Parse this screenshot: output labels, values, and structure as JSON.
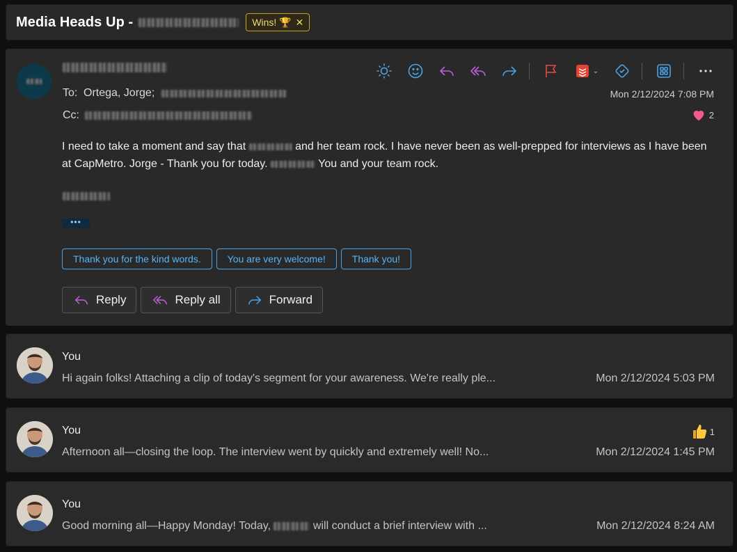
{
  "subject": {
    "title": "Media Heads Up -",
    "category": "Wins! 🏆",
    "category_close": "✕"
  },
  "message": {
    "to_label": "To:",
    "to_value": "Ortega, Jorge;",
    "cc_label": "Cc:",
    "date": "Mon 2/12/2024 7:08 PM",
    "reaction_count": "2",
    "body_part1": "I need to take a moment and say that",
    "body_part2": "and her team rock.  I have never been as well-prepped for interviews as I have been at CapMetro.  Jorge -  Thank you for today.",
    "body_part3": "You and your team rock.",
    "ellipsis": "•••",
    "suggestions": [
      "Thank you for the kind words.",
      "You are very welcome!",
      "Thank you!"
    ],
    "actions": {
      "reply": "Reply",
      "reply_all": "Reply all",
      "forward": "Forward"
    }
  },
  "thread": [
    {
      "name": "You",
      "preview": "Hi again folks! Attaching a clip of today's segment for your awareness. We're really ple...",
      "date": "Mon 2/12/2024 5:03 PM"
    },
    {
      "name": "You",
      "preview": "Afternoon all—closing the loop. The interview went by quickly and extremely well! No...",
      "date": "Mon 2/12/2024 1:45 PM",
      "reaction_count": "1"
    },
    {
      "name": "You",
      "preview_part1": "Good morning all—Happy Monday! Today,",
      "preview_part2": "will conduct a brief interview with ...",
      "date": "Mon 2/12/2024 8:24 AM"
    }
  ],
  "colors": {
    "accent": "#4aa3e8",
    "tag": "#c9a227",
    "pink": "#c05fd8"
  }
}
